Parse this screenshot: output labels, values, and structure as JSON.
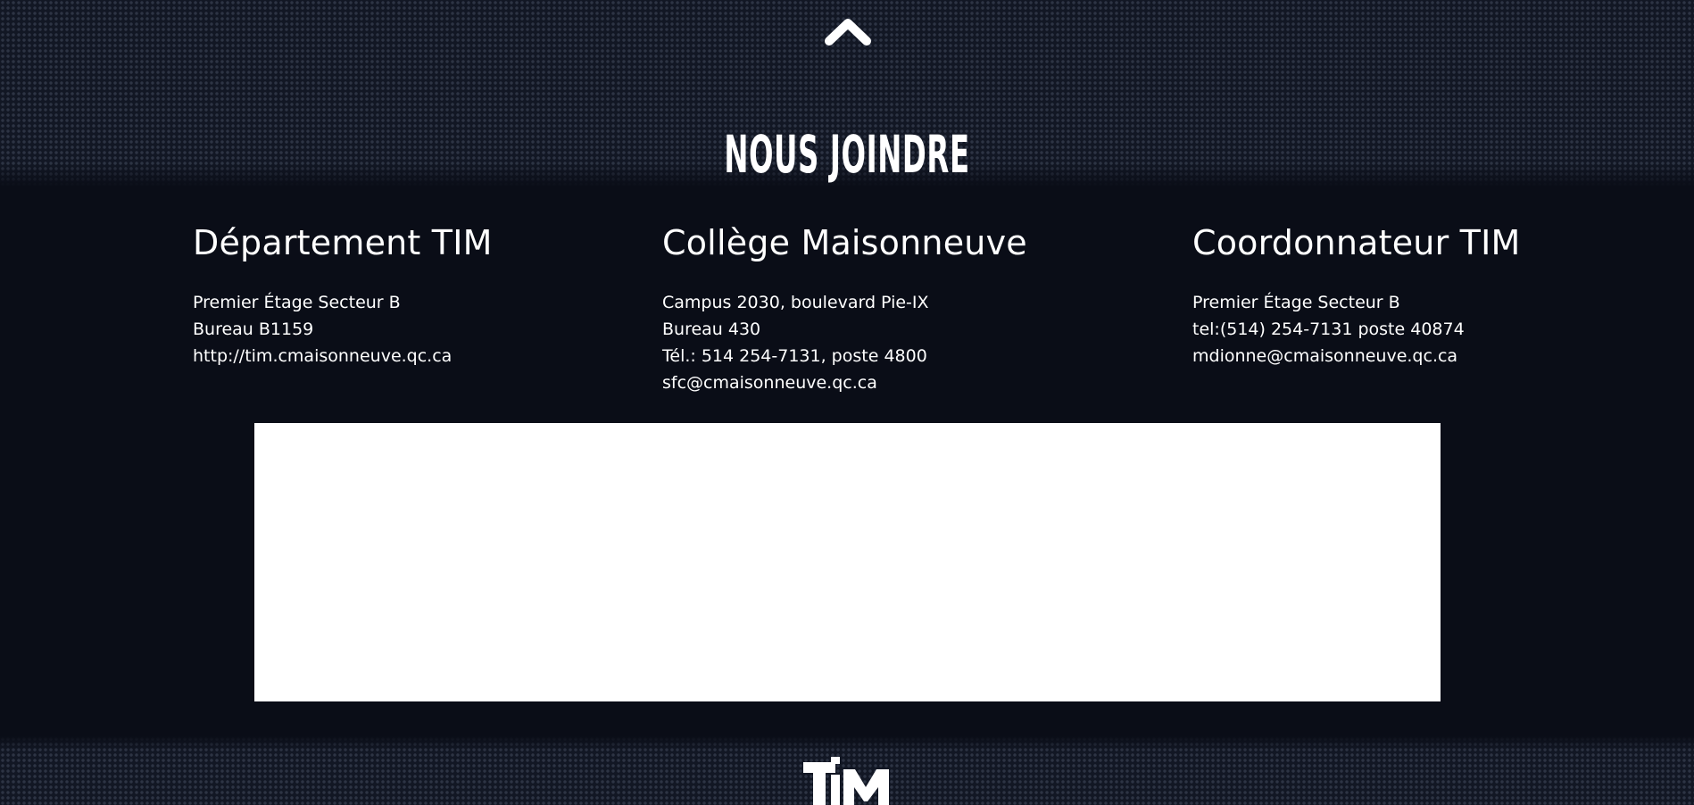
{
  "back_to_top": {
    "icon": "chevron-up-icon"
  },
  "section": {
    "title": "NOUS JOINDRE"
  },
  "columns": [
    {
      "heading": "Département TIM",
      "lines": [
        "Premier Étage Secteur B",
        "Bureau B1159",
        "http://tim.cmaisonneuve.qc.ca"
      ]
    },
    {
      "heading": "Collège Maisonneuve",
      "lines": [
        "Campus 2030, boulevard Pie-IX",
        "Bureau 430",
        "Tél.: 514 254-7131, poste 4800",
        "sfc@cmaisonneuve.qc.ca"
      ]
    },
    {
      "heading": "Coordonnateur TIM",
      "lines": [
        "Premier Étage Secteur B",
        "tel:(514) 254-7131 poste 40874",
        "mdionne@cmaisonneuve.qc.ca"
      ]
    }
  ],
  "footer": {
    "logo_text": "TIM"
  },
  "colors": {
    "background": "#0a0d17",
    "text": "#ffffff",
    "map_area": "#ffffff"
  }
}
